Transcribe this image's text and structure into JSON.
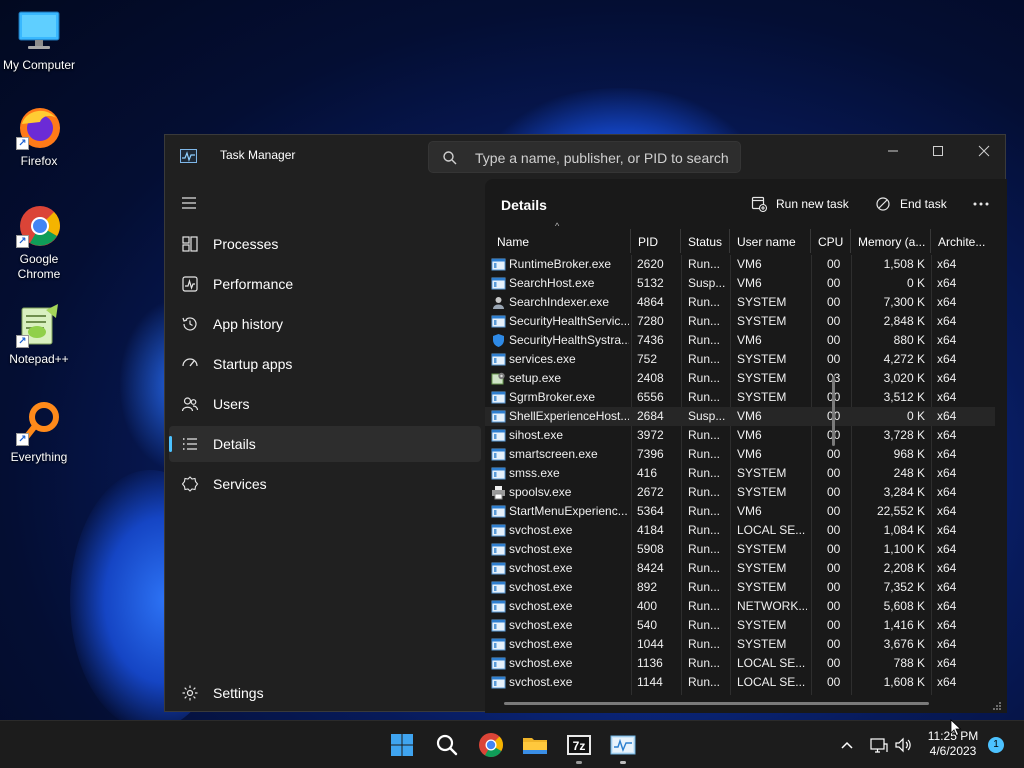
{
  "desktop": {
    "icons": [
      {
        "label": "My Computer",
        "icon": "monitor-icon"
      },
      {
        "label": "Firefox",
        "icon": "firefox-icon"
      },
      {
        "label": "Google Chrome",
        "icon": "chrome-icon"
      },
      {
        "label": "Notepad++",
        "icon": "notepadpp-icon"
      },
      {
        "label": "Everything",
        "icon": "everything-search-icon"
      }
    ]
  },
  "window": {
    "title": "Task Manager",
    "search_placeholder": "Type a name, publisher, or PID to search"
  },
  "nav": {
    "items": [
      {
        "label": "Processes",
        "icon": "processes-icon"
      },
      {
        "label": "Performance",
        "icon": "performance-icon"
      },
      {
        "label": "App history",
        "icon": "history-icon"
      },
      {
        "label": "Startup apps",
        "icon": "startup-icon"
      },
      {
        "label": "Users",
        "icon": "users-icon"
      },
      {
        "label": "Details",
        "icon": "details-icon"
      },
      {
        "label": "Services",
        "icon": "services-icon"
      }
    ],
    "active": "Details",
    "settings_label": "Settings"
  },
  "details": {
    "title": "Details",
    "run_new_task_label": "Run new task",
    "end_task_label": "End task",
    "columns": [
      "Name",
      "PID",
      "Status",
      "User name",
      "CPU",
      "Memory (a...",
      "Archite..."
    ],
    "rows": [
      {
        "name": "RuntimeBroker.exe",
        "pid": "2620",
        "status": "Run...",
        "user": "VM6",
        "cpu": "00",
        "mem": "1,508 K",
        "arch": "x64",
        "icon": "window-process-icon"
      },
      {
        "name": "SearchHost.exe",
        "pid": "5132",
        "status": "Susp...",
        "user": "VM6",
        "cpu": "00",
        "mem": "0 K",
        "arch": "x64",
        "icon": "window-process-icon"
      },
      {
        "name": "SearchIndexer.exe",
        "pid": "4864",
        "status": "Run...",
        "user": "SYSTEM",
        "cpu": "00",
        "mem": "7,300 K",
        "arch": "x64",
        "icon": "indexer-icon"
      },
      {
        "name": "SecurityHealthServic...",
        "pid": "7280",
        "status": "Run...",
        "user": "SYSTEM",
        "cpu": "00",
        "mem": "2,848 K",
        "arch": "x64",
        "icon": "window-process-icon"
      },
      {
        "name": "SecurityHealthSystra...",
        "pid": "7436",
        "status": "Run...",
        "user": "VM6",
        "cpu": "00",
        "mem": "880 K",
        "arch": "x64",
        "icon": "shield-icon"
      },
      {
        "name": "services.exe",
        "pid": "752",
        "status": "Run...",
        "user": "SYSTEM",
        "cpu": "00",
        "mem": "4,272 K",
        "arch": "x64",
        "icon": "window-process-icon"
      },
      {
        "name": "setup.exe",
        "pid": "2408",
        "status": "Run...",
        "user": "SYSTEM",
        "cpu": "03",
        "mem": "3,020 K",
        "arch": "x64",
        "icon": "setup-icon"
      },
      {
        "name": "SgrmBroker.exe",
        "pid": "6556",
        "status": "Run...",
        "user": "SYSTEM",
        "cpu": "00",
        "mem": "3,512 K",
        "arch": "x64",
        "icon": "window-process-icon"
      },
      {
        "name": "ShellExperienceHost....",
        "pid": "2684",
        "status": "Susp...",
        "user": "VM6",
        "cpu": "00",
        "mem": "0 K",
        "arch": "x64",
        "icon": "window-process-icon"
      },
      {
        "name": "sihost.exe",
        "pid": "3972",
        "status": "Run...",
        "user": "VM6",
        "cpu": "00",
        "mem": "3,728 K",
        "arch": "x64",
        "icon": "window-process-icon"
      },
      {
        "name": "smartscreen.exe",
        "pid": "7396",
        "status": "Run...",
        "user": "VM6",
        "cpu": "00",
        "mem": "968 K",
        "arch": "x64",
        "icon": "window-process-icon"
      },
      {
        "name": "smss.exe",
        "pid": "416",
        "status": "Run...",
        "user": "SYSTEM",
        "cpu": "00",
        "mem": "248 K",
        "arch": "x64",
        "icon": "window-process-icon"
      },
      {
        "name": "spoolsv.exe",
        "pid": "2672",
        "status": "Run...",
        "user": "SYSTEM",
        "cpu": "00",
        "mem": "3,284 K",
        "arch": "x64",
        "icon": "printer-icon"
      },
      {
        "name": "StartMenuExperienc...",
        "pid": "5364",
        "status": "Run...",
        "user": "VM6",
        "cpu": "00",
        "mem": "22,552 K",
        "arch": "x64",
        "icon": "window-process-icon"
      },
      {
        "name": "svchost.exe",
        "pid": "4184",
        "status": "Run...",
        "user": "LOCAL SE...",
        "cpu": "00",
        "mem": "1,084 K",
        "arch": "x64",
        "icon": "window-process-icon"
      },
      {
        "name": "svchost.exe",
        "pid": "5908",
        "status": "Run...",
        "user": "SYSTEM",
        "cpu": "00",
        "mem": "1,100 K",
        "arch": "x64",
        "icon": "window-process-icon"
      },
      {
        "name": "svchost.exe",
        "pid": "8424",
        "status": "Run...",
        "user": "SYSTEM",
        "cpu": "00",
        "mem": "2,208 K",
        "arch": "x64",
        "icon": "window-process-icon"
      },
      {
        "name": "svchost.exe",
        "pid": "892",
        "status": "Run...",
        "user": "SYSTEM",
        "cpu": "00",
        "mem": "7,352 K",
        "arch": "x64",
        "icon": "window-process-icon"
      },
      {
        "name": "svchost.exe",
        "pid": "400",
        "status": "Run...",
        "user": "NETWORK...",
        "cpu": "00",
        "mem": "5,608 K",
        "arch": "x64",
        "icon": "window-process-icon"
      },
      {
        "name": "svchost.exe",
        "pid": "540",
        "status": "Run...",
        "user": "SYSTEM",
        "cpu": "00",
        "mem": "1,416 K",
        "arch": "x64",
        "icon": "window-process-icon"
      },
      {
        "name": "svchost.exe",
        "pid": "1044",
        "status": "Run...",
        "user": "SYSTEM",
        "cpu": "00",
        "mem": "3,676 K",
        "arch": "x64",
        "icon": "window-process-icon"
      },
      {
        "name": "svchost.exe",
        "pid": "1136",
        "status": "Run...",
        "user": "LOCAL SE...",
        "cpu": "00",
        "mem": "788 K",
        "arch": "x64",
        "icon": "window-process-icon"
      },
      {
        "name": "svchost.exe",
        "pid": "1144",
        "status": "Run...",
        "user": "LOCAL SE...",
        "cpu": "00",
        "mem": "1,608 K",
        "arch": "x64",
        "icon": "window-process-icon"
      }
    ]
  },
  "taskbar": {
    "apps": [
      "windows-start-icon",
      "search-icon",
      "chrome-icon",
      "file-explorer-icon",
      "7zip-icon",
      "task-manager-icon"
    ],
    "sevenzip_label": "7z",
    "clock_time": "11:25 PM",
    "clock_date": "4/6/2023",
    "notification_count": "1"
  },
  "colors": {
    "accent": "#4cc2ff",
    "window_bg": "#202020",
    "panel_bg": "#191919",
    "taskbar_bg": "#1c1c1c"
  }
}
